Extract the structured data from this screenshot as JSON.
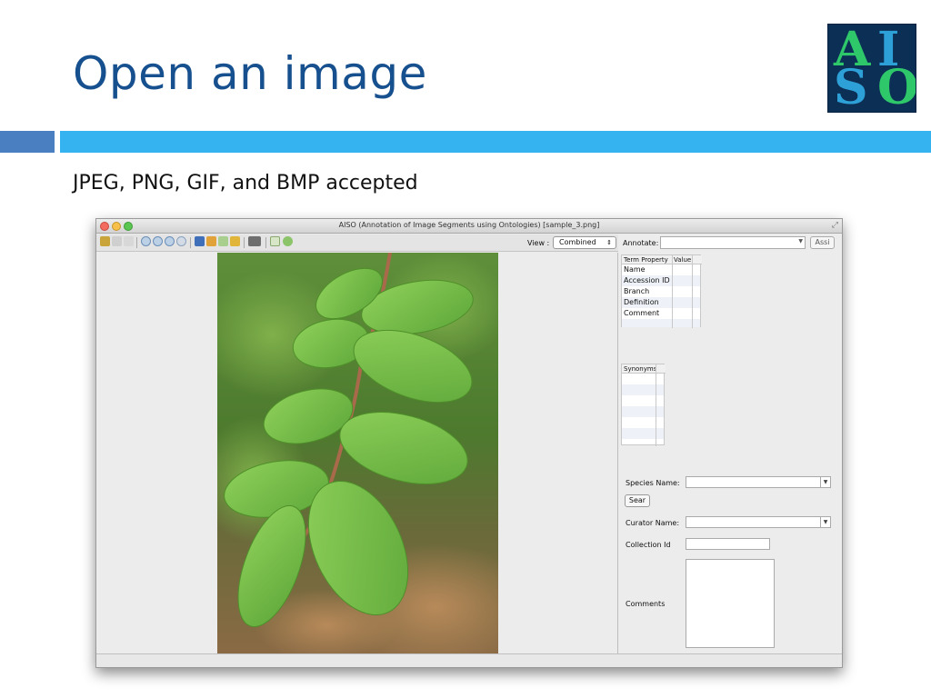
{
  "slide": {
    "title": "Open an image",
    "subtitle": "JPEG, PNG, GIF, and BMP accepted"
  },
  "logo": {
    "letters": [
      "A",
      "I",
      "S",
      "O"
    ]
  },
  "colors": {
    "title": "#17508e",
    "band_left": "#4a7fc1",
    "band_right": "#35b2f0",
    "logo_bg": "#0c2f55"
  },
  "window": {
    "title": "AISO (Annotation of Image Segments using Ontologies) [sample_3.png]"
  },
  "toolbar": {
    "icons": [
      "lock-icon",
      "copy-icon",
      "paste-icon",
      "zoom-in-icon",
      "zoom-out-icon",
      "zoom-fit-icon",
      "zoom-actual-icon",
      "refresh-icon",
      "undo-icon",
      "redo-icon",
      "brush-icon",
      "pen-icon",
      "select-icon",
      "leaf-icon"
    ],
    "view_label": "View :",
    "view_value": "Combined"
  },
  "annotate": {
    "label": "Annotate:",
    "assign_label": "Assi"
  },
  "term_table": {
    "headers": [
      "Term Property",
      "Value"
    ],
    "rows": [
      "Name",
      "Accession ID",
      "Branch",
      "Definition",
      "Comment",
      ""
    ]
  },
  "synonyms_table": {
    "header": "Synonyms",
    "rows": [
      "",
      "",
      "",
      "",
      "",
      "",
      ""
    ]
  },
  "form": {
    "species_label": "Species Name:",
    "search_label": "Sear",
    "curator_label": "Curator Name:",
    "collection_label": "Collection Id",
    "comments_label": "Comments"
  }
}
